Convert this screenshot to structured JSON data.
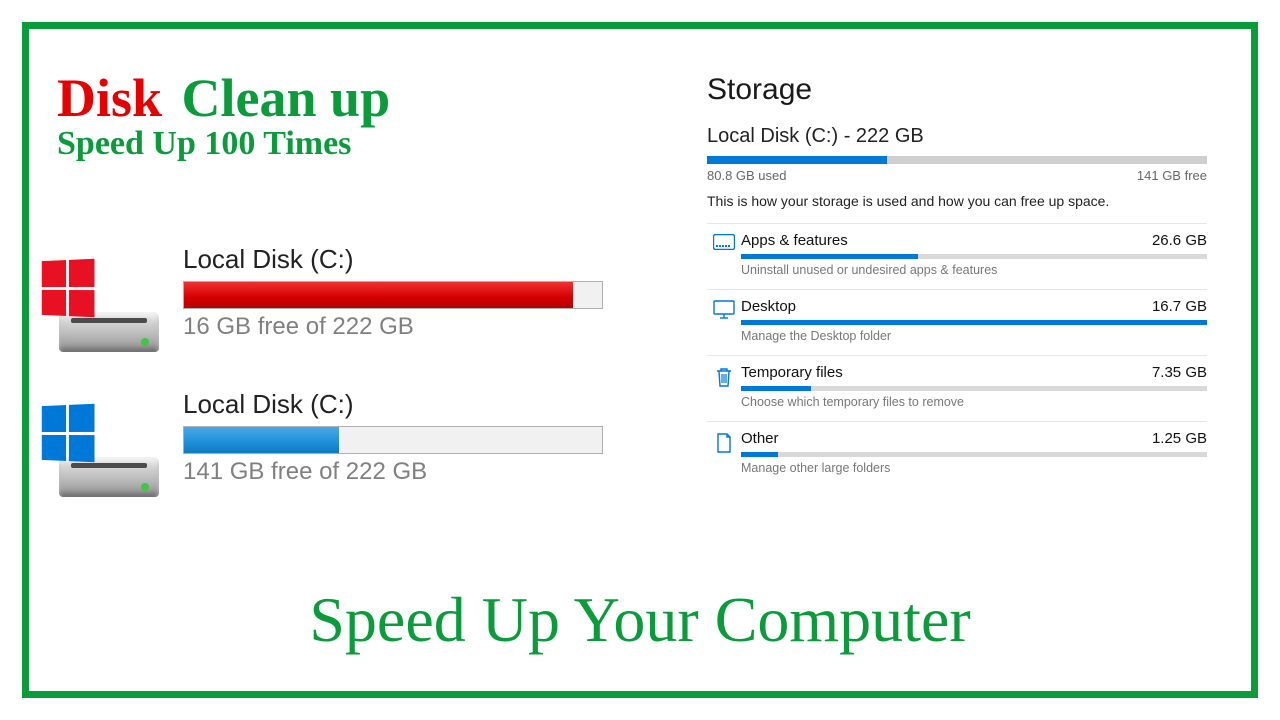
{
  "title": {
    "word1": "Disk",
    "word2": "Clean up",
    "line2": "Speed Up 100 Times"
  },
  "drives": [
    {
      "name": "Local Disk (C:)",
      "free_text": "16 GB free of 222 GB",
      "fill_pct": 93,
      "fill_class": "fill-red",
      "logo": "red"
    },
    {
      "name": "Local Disk (C:)",
      "free_text": "141 GB free of 222 GB",
      "fill_pct": 37,
      "fill_class": "fill-blue",
      "logo": "blue"
    }
  ],
  "bottom": "Speed Up Your Computer",
  "storage": {
    "heading": "Storage",
    "disk_label": "Local Disk (C:) - 222 GB",
    "used_pct": 36,
    "used": "80.8 GB used",
    "free": "141 GB free",
    "desc": "This is how your storage is used and how you can free up space.",
    "categories": [
      {
        "icon": "apps",
        "name": "Apps & features",
        "size": "26.6 GB",
        "pct": 38,
        "sub": "Uninstall unused or undesired apps & features"
      },
      {
        "icon": "desktop",
        "name": "Desktop",
        "size": "16.7 GB",
        "pct": 100,
        "sub": "Manage the Desktop folder"
      },
      {
        "icon": "trash",
        "name": "Temporary files",
        "size": "7.35 GB",
        "pct": 15,
        "sub": "Choose which temporary files to remove"
      },
      {
        "icon": "other",
        "name": "Other",
        "size": "1.25 GB",
        "pct": 8,
        "sub": "Manage other large folders"
      }
    ]
  }
}
